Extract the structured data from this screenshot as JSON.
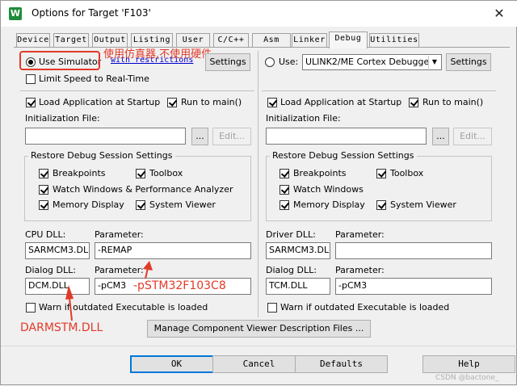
{
  "window": {
    "title": "Options for Target 'F103'",
    "close_glyph": "✕"
  },
  "tabs": [
    "Device",
    "Target",
    "Output",
    "Listing",
    "User",
    "C/C++",
    "Asm",
    "Linker",
    "Debug",
    "Utilities"
  ],
  "left": {
    "use_simulator": {
      "label": "Use Simulator",
      "selected": true
    },
    "with_restrictions": "with restrictions",
    "settings": "Settings",
    "limit_speed": {
      "label": "Limit Speed to Real-Time",
      "checked": false
    },
    "load_app": {
      "label": "Load Application at Startup",
      "checked": true
    },
    "run_to_main": {
      "label": "Run to main()",
      "checked": true
    },
    "init_file_label": "Initialization File:",
    "init_file_value": "",
    "browse": "...",
    "edit": "Edit...",
    "restore_title": "Restore Debug Session Settings",
    "restore": {
      "breakpoints": "Breakpoints",
      "toolbox": "Toolbox",
      "watch": "Watch Windows & Performance Analyzer",
      "memory": "Memory Display",
      "system_viewer": "System Viewer"
    },
    "cpu_dll_label": "CPU DLL:",
    "cpu_param_label": "Parameter:",
    "cpu_dll": "SARMCM3.DLL",
    "cpu_param": "-REMAP",
    "dialog_dll_label": "Dialog DLL:",
    "dialog_param_label": "Parameter:",
    "dialog_dll": "DCM.DLL",
    "dialog_param": "-pCM3",
    "warn": "Warn if outdated Executable is loaded"
  },
  "right": {
    "use": {
      "label": "Use:",
      "selected": false
    },
    "debugger": "ULINK2/ME Cortex Debugger",
    "settings": "Settings",
    "load_app": {
      "label": "Load Application at Startup",
      "checked": true
    },
    "run_to_main": {
      "label": "Run to main()",
      "checked": true
    },
    "init_file_label": "Initialization File:",
    "init_file_value": "",
    "browse": "...",
    "edit": "Edit...",
    "restore_title": "Restore Debug Session Settings",
    "restore": {
      "breakpoints": "Breakpoints",
      "toolbox": "Toolbox",
      "watch": "Watch Windows",
      "memory": "Memory Display",
      "system_viewer": "System Viewer"
    },
    "driver_dll_label": "Driver DLL:",
    "driver_param_label": "Parameter:",
    "driver_dll": "SARMCM3.DLL",
    "driver_param": "",
    "dialog_dll_label": "Dialog DLL:",
    "dialog_param_label": "Parameter:",
    "dialog_dll": "TCM.DLL",
    "dialog_param": "-pCM3",
    "warn": "Warn if outdated Executable is loaded"
  },
  "manage_button": "Manage Component Viewer Description Files ...",
  "footer": {
    "ok": "OK",
    "cancel": "Cancel",
    "defaults": "Defaults",
    "help": "Help"
  },
  "annotations": {
    "simulator_note": "使用仿真器,不使用硬件",
    "param_note": "-pSTM32F103C8",
    "dll_note": "DARMSTM.DLL",
    "color": "#e23a28"
  },
  "watermark": "CSDN @bactone_"
}
